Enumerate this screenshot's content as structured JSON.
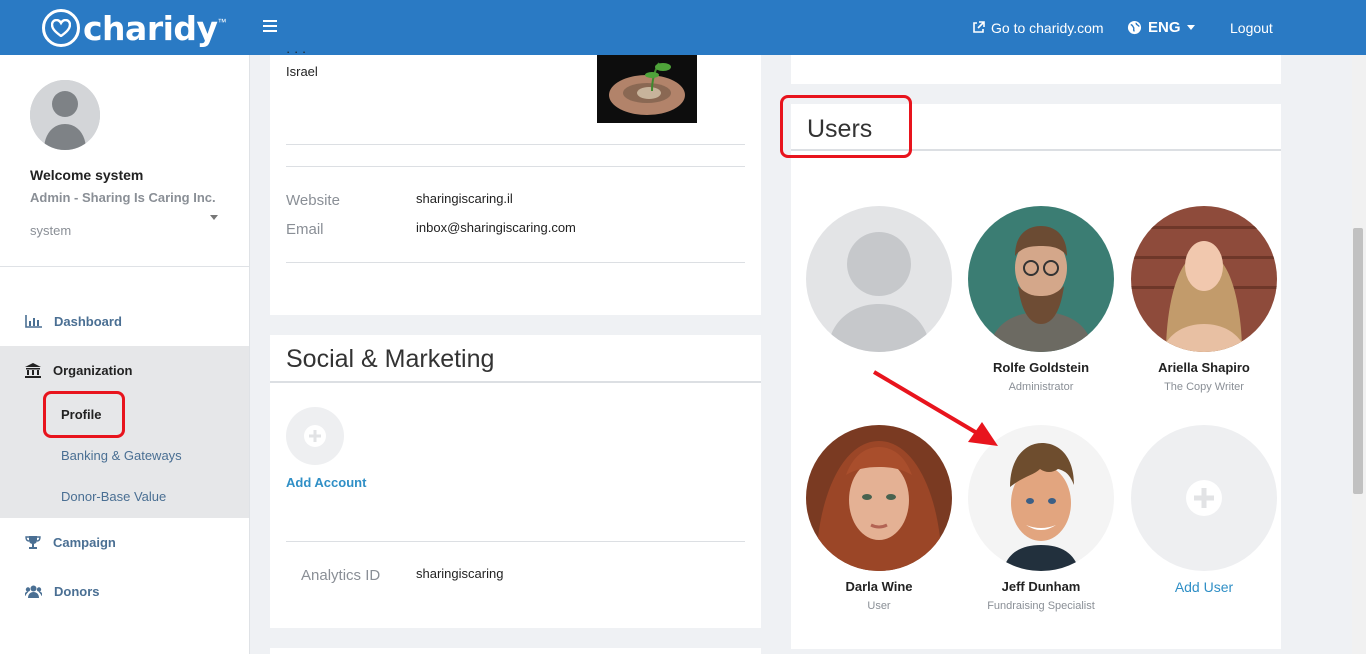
{
  "header": {
    "logo_text": "charidy",
    "go_to_label": "Go to charidy.com",
    "language": "ENG",
    "logout_label": "Logout"
  },
  "sidebar": {
    "welcome": "Welcome system",
    "org_line": "Admin - Sharing Is Caring Inc.",
    "user_line": "system",
    "menu": {
      "dashboard": "Dashboard",
      "organization": "Organization",
      "profile": "Profile",
      "banking": "Banking & Gateways",
      "donor_base": "Donor-Base Value",
      "campaign": "Campaign",
      "donors": "Donors"
    }
  },
  "profile_card": {
    "country": "Israel",
    "website_label": "Website",
    "website_value": "sharingiscaring.il",
    "email_label": "Email",
    "email_value": "inbox@sharingiscaring.com"
  },
  "social": {
    "title": "Social & Marketing",
    "add_account": "Add Account",
    "analytics_label": "Analytics ID",
    "analytics_value": "sharingiscaring"
  },
  "users": {
    "title": "Users",
    "list": [
      {
        "name": "Rolfe Goldstein",
        "role": "Administrator"
      },
      {
        "name": "Ariella Shapiro",
        "role": "The Copy Writer"
      },
      {
        "name": "Darla Wine",
        "role": "User"
      },
      {
        "name": "Jeff Dunham",
        "role": "Fundraising Specialist"
      }
    ],
    "add_user": "Add User"
  },
  "colors": {
    "header": "#2a7ac4",
    "link": "#2f8fc6",
    "menu": "#4a6f93",
    "annotation": "#e8141d"
  }
}
